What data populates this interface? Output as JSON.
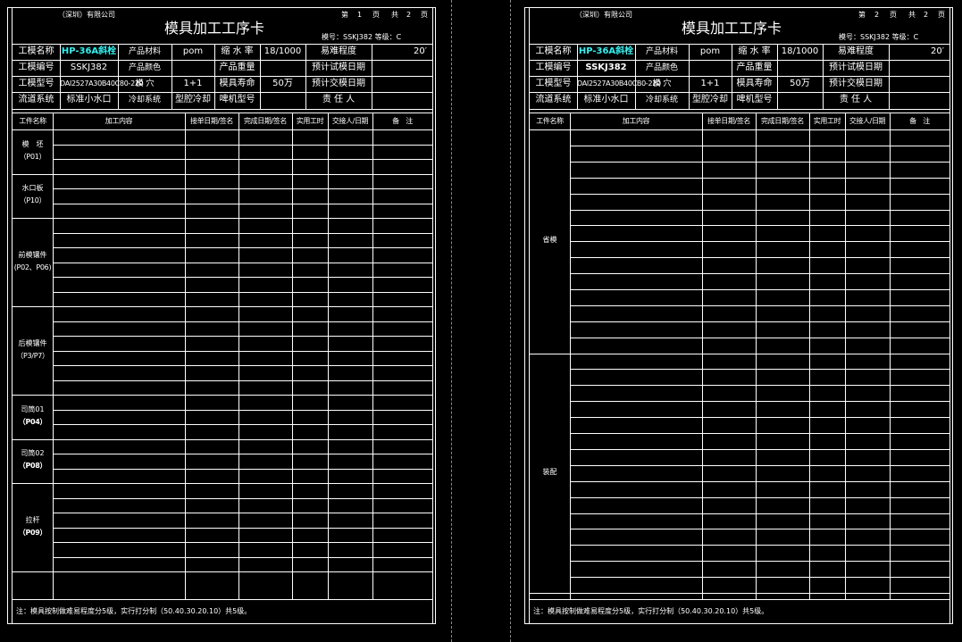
{
  "pages": [
    {
      "company": "（深圳）有限公司",
      "page_di": "第",
      "page_no": "1",
      "page_ye1": "页",
      "page_gong": "共",
      "page_total": "2",
      "page_ye2": "页",
      "title": "模具加工工序卡",
      "mold_no": "模号：SSKJ382  等级：C",
      "info": [
        [
          "工模名称",
          "HP-36A斜栓",
          "产品材料",
          "pom",
          "缩 水 率",
          "18/1000",
          "易难程度",
          "20′"
        ],
        [
          "工模编号",
          "SSKJ382",
          "产品颜色",
          "",
          "产品重量",
          "",
          "预计试模日期",
          ""
        ],
        [
          "工模型号",
          "DAI2527A30B40C80-220",
          "模 穴",
          "1+1",
          "模具寿命",
          "50万",
          "预计交模日期",
          ""
        ],
        [
          "流道系统",
          "标准小水口",
          "冷却系统",
          "型腔冷却",
          "啤机型号",
          "",
          "责 任 人",
          ""
        ]
      ],
      "headers": [
        "工件名称",
        "加工内容",
        "接单日期/签名",
        "完成日期/签名",
        "实用工时",
        "交接人/日期",
        "备　注"
      ],
      "groups": [
        {
          "l1": "模　坯",
          "l2": "（P01）"
        },
        {
          "l1": "水口板",
          "l2": "（P10）"
        },
        {
          "l1": "前模镶件",
          "l2": "(P02、P06)"
        },
        {
          "l1": "后模镶件",
          "l2": "（P3/P7）"
        },
        {
          "l1": "司筒01",
          "l2": "（P04）"
        },
        {
          "l1": "司筒02",
          "l2": "（P08）"
        },
        {
          "l1": "拉杆",
          "l2": "（P09）"
        }
      ],
      "footer": "注：模具按制做难易程度分5级，实行打分制（50.40.30.20.10）共5级。"
    },
    {
      "company": "（深圳）有限公司",
      "page_di": "第",
      "page_no": "2",
      "page_ye1": "页",
      "page_gong": "共",
      "page_total": "2",
      "page_ye2": "页",
      "title": "模具加工工序卡",
      "mold_no": "模号：SSKJ382  等级：C",
      "info": [
        [
          "工模名称",
          "HP-36A斜栓",
          "产品材料",
          "pom",
          "缩 水 率",
          "18/1000",
          "易难程度",
          "20′"
        ],
        [
          "工模编号",
          "SSKJ382",
          "产品颜色",
          "",
          "产品重量",
          "",
          "预计试模日期",
          ""
        ],
        [
          "工模型号",
          "DAI2527A30B40CB0-220",
          "模 穴",
          "1+1",
          "模具寿命",
          "50万",
          "预计交模日期",
          ""
        ],
        [
          "流道系统",
          "标准小水口",
          "冷却系统",
          "型腔冷却",
          "啤机型号",
          "",
          "责 任 人",
          ""
        ]
      ],
      "headers": [
        "工件名称",
        "加工内容",
        "接单日期/签名",
        "完成日期/签名",
        "实用工时",
        "交接人/日期",
        "备　注"
      ],
      "groups": [
        {
          "l1": "省模",
          "l2": ""
        },
        {
          "l1": "装配",
          "l2": ""
        }
      ],
      "footer": "注：模具按制做难易程度分5级，实行打分制（50.40.30.20.10）共5级。"
    }
  ],
  "colors": {
    "background": "#000000",
    "line": "#ffffff",
    "highlight": "#35f0f0"
  }
}
